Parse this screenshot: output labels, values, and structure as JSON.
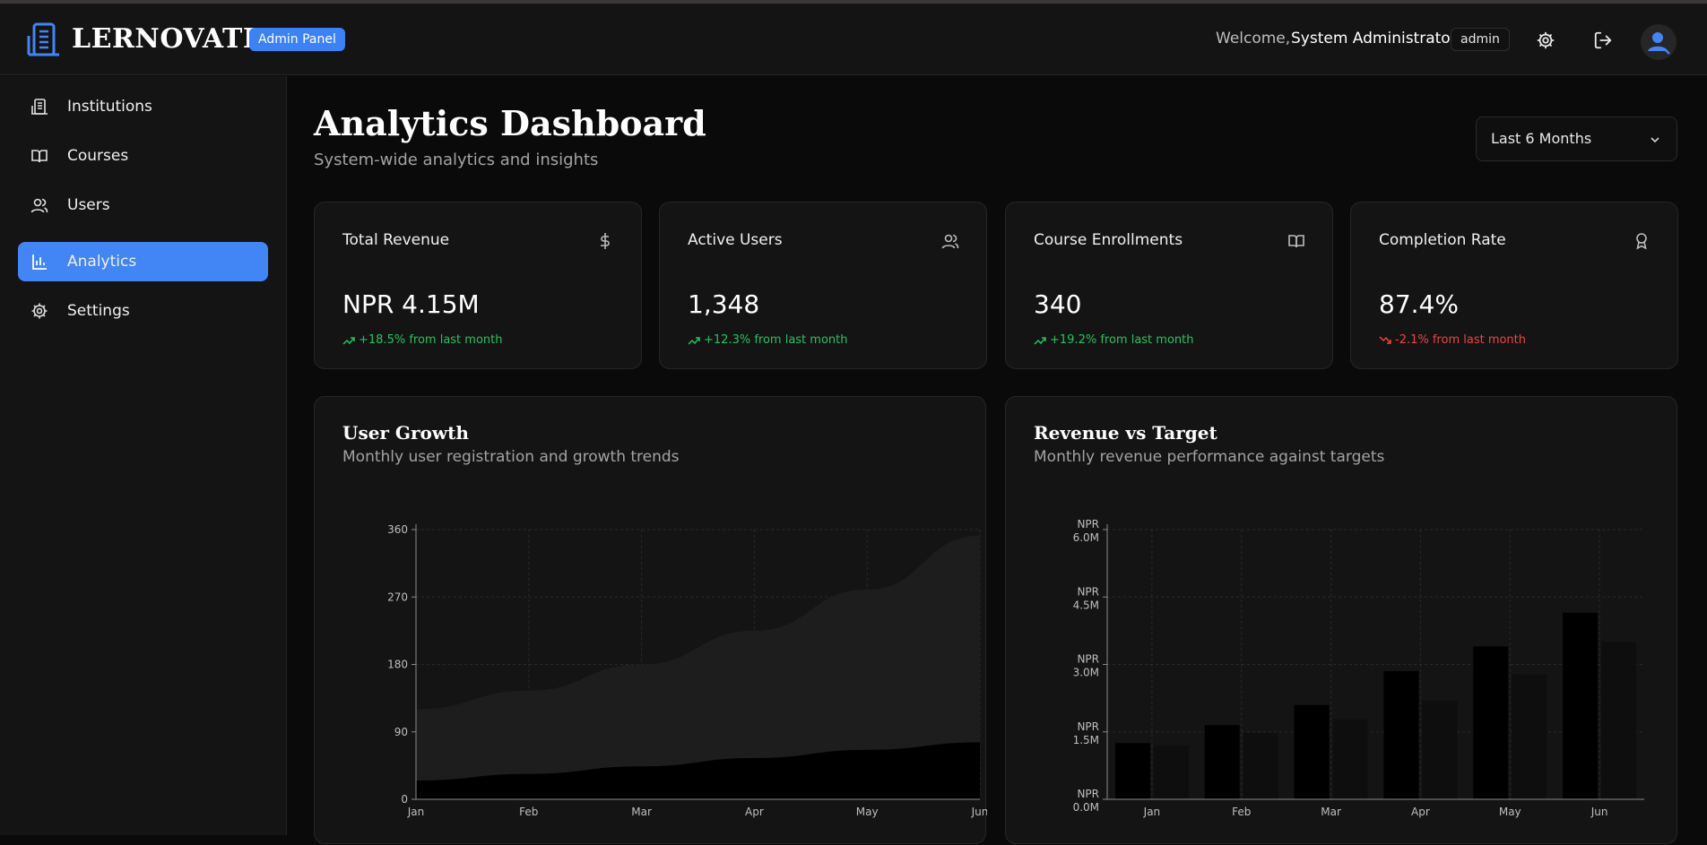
{
  "app": {
    "brand": "LERNOVATE",
    "badge": "Admin Panel",
    "welcome_prefix": "Welcome,",
    "user_name": "System Administrator",
    "role": "admin"
  },
  "sidebar": {
    "items": [
      {
        "label": "Institutions",
        "icon": "building-icon",
        "active": false
      },
      {
        "label": "Courses",
        "icon": "book-open-icon",
        "active": false
      },
      {
        "label": "Users",
        "icon": "users-icon",
        "active": false
      },
      {
        "label": "Analytics",
        "icon": "bar-chart-icon",
        "active": true
      },
      {
        "label": "Settings",
        "icon": "gear-icon",
        "active": false
      }
    ]
  },
  "page": {
    "title": "Analytics Dashboard",
    "subtitle": "System-wide analytics and insights",
    "range_selected": "Last 6 Months"
  },
  "cards": [
    {
      "title": "Total Revenue",
      "icon": "dollar-icon",
      "value": "NPR 4.15M",
      "change": "+18.5% from last month",
      "trend": "up"
    },
    {
      "title": "Active Users",
      "icon": "users-icon",
      "value": "1,348",
      "change": "+12.3% from last month",
      "trend": "up"
    },
    {
      "title": "Course Enrollments",
      "icon": "book-open-icon",
      "value": "340",
      "change": "+19.2% from last month",
      "trend": "up"
    },
    {
      "title": "Completion Rate",
      "icon": "award-icon",
      "value": "87.4%",
      "change": "-2.1% from last month",
      "trend": "down"
    }
  ],
  "panels": {
    "growth": {
      "title": "User Growth",
      "subtitle": "Monthly user registration and growth trends"
    },
    "revenue": {
      "title": "Revenue vs Target",
      "subtitle": "Monthly revenue performance against targets"
    }
  },
  "colors": {
    "accent": "#4285f4",
    "up": "#22c55e",
    "down": "#ef4444"
  },
  "chart_data": [
    {
      "type": "area",
      "title": "User Growth",
      "categories": [
        "Jan",
        "Feb",
        "Mar",
        "Apr",
        "May",
        "Jun"
      ],
      "yticks": [
        0,
        90,
        180,
        270,
        360
      ],
      "ylim": [
        0,
        360
      ],
      "grid": true,
      "series": [
        {
          "values": [
            120,
            145,
            180,
            225,
            280,
            352
          ]
        },
        {
          "values": [
            25,
            34,
            44,
            55,
            66,
            76
          ]
        }
      ]
    },
    {
      "type": "bar",
      "title": "Revenue vs Target",
      "categories": [
        "Jan",
        "Feb",
        "Mar",
        "Apr",
        "May",
        "Jun"
      ],
      "ytick_labels": [
        [
          "NPR",
          "0.0M"
        ],
        [
          "NPR",
          "1.5M"
        ],
        [
          "NPR",
          "3.0M"
        ],
        [
          "NPR",
          "4.5M"
        ],
        [
          "NPR",
          "6.0M"
        ]
      ],
      "ytick_values": [
        0,
        1.5,
        3.0,
        4.5,
        6.0
      ],
      "ylim": [
        0,
        6.0
      ],
      "grid": true,
      "series": [
        {
          "values": [
            1.25,
            1.65,
            2.1,
            2.85,
            3.4,
            4.15
          ]
        },
        {
          "values": [
            1.2,
            1.48,
            1.78,
            2.2,
            2.78,
            3.5
          ]
        }
      ]
    }
  ]
}
